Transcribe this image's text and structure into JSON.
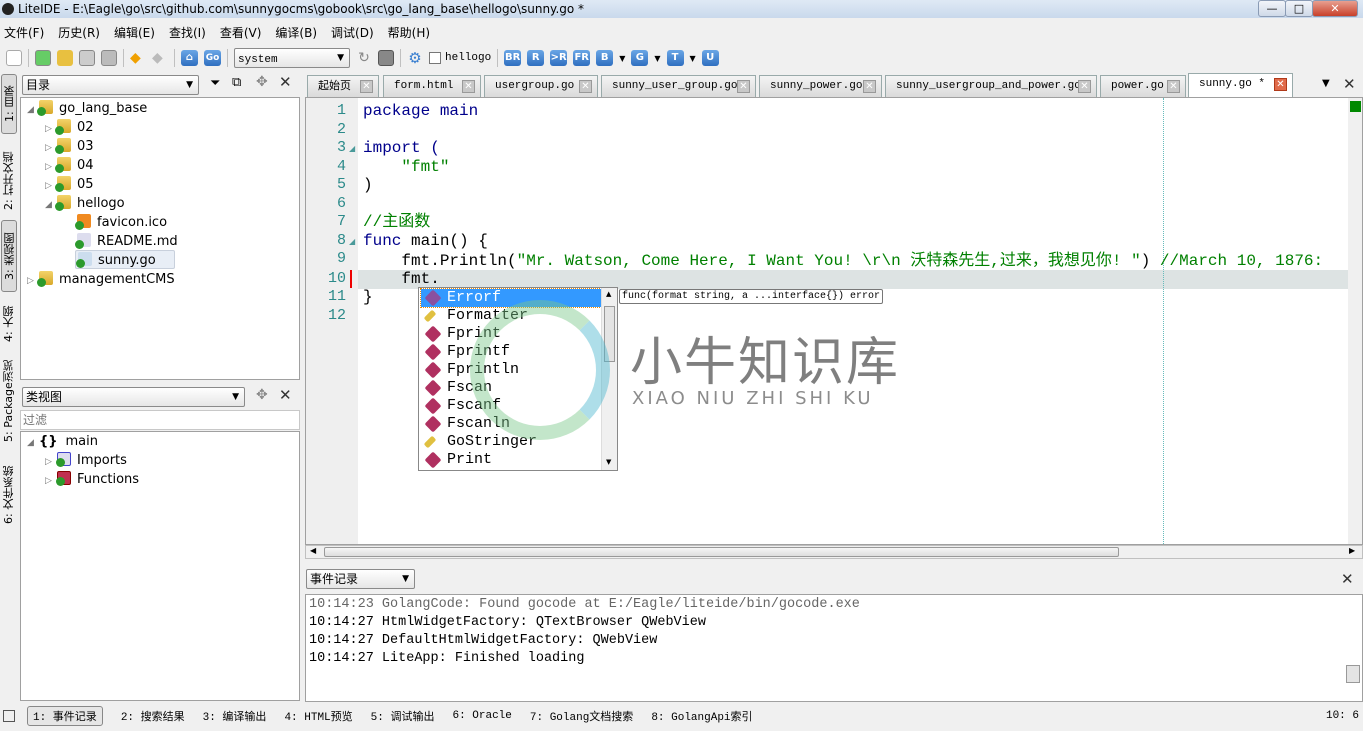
{
  "window": {
    "title": "LiteIDE - E:\\Eagle\\go\\src\\github.com\\sunnygocms\\gobook\\src\\go_lang_base\\hellogo\\sunny.go *",
    "minimize": "—",
    "maximize": "□",
    "close": "✕"
  },
  "menu": [
    "文件(F)",
    "历史(R)",
    "编辑(E)",
    "查找(I)",
    "查看(V)",
    "编译(B)",
    "调试(D)",
    "帮助(H)"
  ],
  "toolbar": {
    "env_combo": "system",
    "build_target_checkbox": "hellogo",
    "build_buttons": [
      "BR",
      "R",
      ">R",
      "FR",
      "B",
      "G",
      "T",
      "U"
    ]
  },
  "left_tabs": [
    "1: 目录",
    "2: 打开文档",
    "3: 类视图",
    "4: 大纲",
    "5: Package浏览",
    "6: 文件系统"
  ],
  "dir_panel": {
    "combo": "目录",
    "tree": [
      {
        "label": "go_lang_base",
        "indent": 0,
        "expanded": true
      },
      {
        "label": "02",
        "indent": 1
      },
      {
        "label": "03",
        "indent": 1
      },
      {
        "label": "04",
        "indent": 1
      },
      {
        "label": "05",
        "indent": 1
      },
      {
        "label": "hellogo",
        "indent": 1,
        "expanded": true
      },
      {
        "label": "favicon.ico",
        "indent": 2
      },
      {
        "label": "README.md",
        "indent": 2
      },
      {
        "label": "sunny.go",
        "indent": 2,
        "selected": true
      },
      {
        "label": "managementCMS",
        "indent": 0
      }
    ]
  },
  "class_panel": {
    "combo": "类视图",
    "filter_placeholder": "过滤",
    "tree": [
      {
        "label": "main"
      },
      {
        "label": "Imports"
      },
      {
        "label": "Functions"
      }
    ]
  },
  "tabs": [
    {
      "label": "起始页"
    },
    {
      "label": "form.html"
    },
    {
      "label": "usergroup.go"
    },
    {
      "label": "sunny_user_group.go"
    },
    {
      "label": "sunny_power.go"
    },
    {
      "label": "sunny_usergroup_and_power.go"
    },
    {
      "label": "power.go"
    },
    {
      "label": "sunny.go *",
      "active": true
    }
  ],
  "code": {
    "line_numbers": [
      "1",
      "2",
      "3",
      "4",
      "5",
      "6",
      "7",
      "8",
      "9",
      "10",
      "11",
      "12"
    ],
    "l1a": "package",
    "l1b": " main",
    "l3a": "import",
    "l3b": " (",
    "l4": "    \"fmt\"",
    "l5": ")",
    "l7": "//主函数",
    "l8a": "func",
    "l8b": " main() {",
    "l9a": "    fmt.Println(",
    "l9b": "\"Mr. Watson, Come Here, I Want You! \\r\\n 沃特森先生,过来，我想见你! \"",
    "l9c": ") ",
    "l9d": "//March 10, 1876:",
    "l10": "    fmt.",
    "l11": "}"
  },
  "completion": {
    "items": [
      "Errorf",
      "Formatter",
      "Fprint",
      "Fprintf",
      "Fprintln",
      "Fscan",
      "Fscanf",
      "Fscanln",
      "GoStringer",
      "Print"
    ],
    "selected": "Errorf",
    "tooltip": "func(format string, a ...interface{}) error"
  },
  "output": {
    "combo": "事件记录",
    "lines": [
      "10:14:23 GolangCode: Found gocode at E:/Eagle/liteide/bin/gocode.exe",
      "10:14:27 HtmlWidgetFactory: QTextBrowser QWebView",
      "10:14:27 DefaultHtmlWidgetFactory: QWebView",
      "10:14:27 LiteApp: Finished loading"
    ]
  },
  "statusbar": {
    "tabs": [
      "1: 事件记录",
      "2: 搜索结果",
      "3: 编译输出",
      "4: HTML预览",
      "5: 调试输出",
      "6: Oracle",
      "7: Golang文档搜索",
      "8: GolangApi索引"
    ],
    "position": "10: 6"
  },
  "watermark": {
    "title": "小牛知识库",
    "subtitle": "XIAO NIU ZHI SHI KU"
  },
  "colors": {
    "keyword": "#00008b",
    "string": "#008000",
    "selection": "#3399ff",
    "current_line": "#dde3e3"
  }
}
